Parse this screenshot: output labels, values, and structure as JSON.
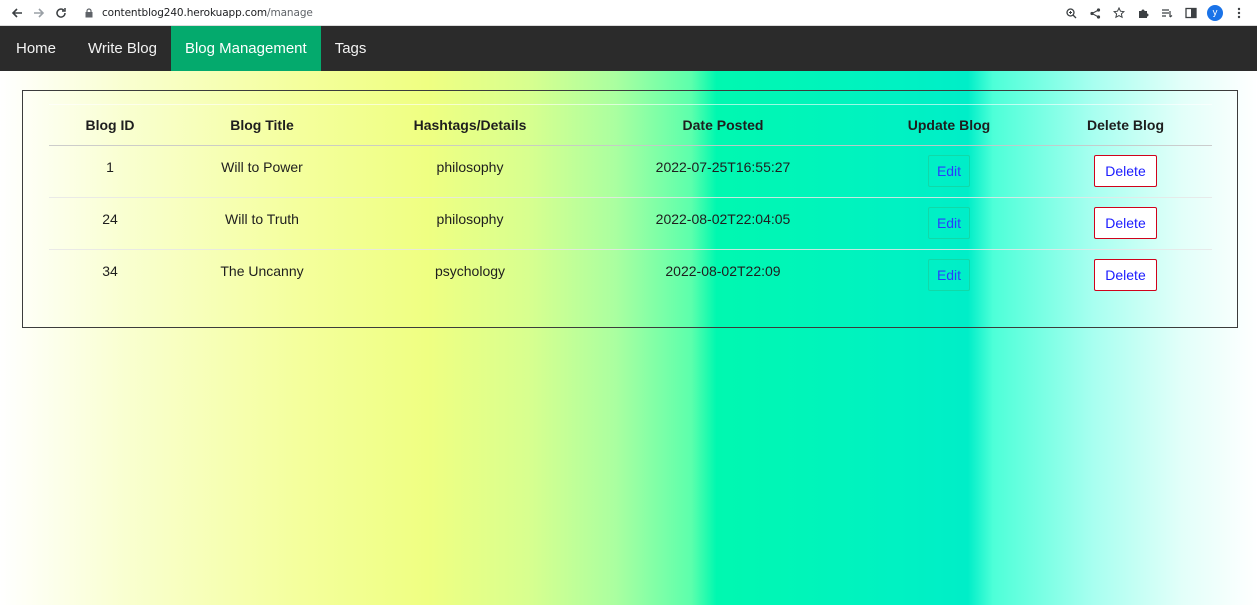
{
  "browser": {
    "url_host": "contentblog240.herokuapp.com",
    "url_path": "/manage",
    "avatar_letter": "y",
    "icons": [
      "back-icon",
      "forward-icon",
      "reload-icon",
      "lock-icon",
      "zoom-icon",
      "share-icon",
      "star-icon",
      "extensions-icon",
      "reading-list-icon",
      "side-panel-icon",
      "profile-avatar",
      "menu-icon"
    ]
  },
  "nav": {
    "items": [
      {
        "label": "Home"
      },
      {
        "label": "Write Blog"
      },
      {
        "label": "Blog Management"
      },
      {
        "label": "Tags"
      }
    ],
    "active_index": 2,
    "active_color": "#04aa6d",
    "bar_color": "#2b2b2b"
  },
  "table": {
    "headers": [
      "Blog ID",
      "Blog Title",
      "Hashtags/Details",
      "Date Posted",
      "Update Blog",
      "Delete Blog"
    ],
    "rows": [
      {
        "id": "1",
        "title": "Will to Power",
        "tags": "philosophy",
        "date": "2022-07-25T16:55:27",
        "edit": "Edit",
        "delete": "Delete"
      },
      {
        "id": "24",
        "title": "Will to Truth",
        "tags": "philosophy",
        "date": "2022-08-02T22:04:05",
        "edit": "Edit",
        "delete": "Delete"
      },
      {
        "id": "34",
        "title": "The Uncanny",
        "tags": "psychology",
        "date": "2022-08-02T22:09",
        "edit": "Edit",
        "delete": "Delete"
      }
    ]
  }
}
